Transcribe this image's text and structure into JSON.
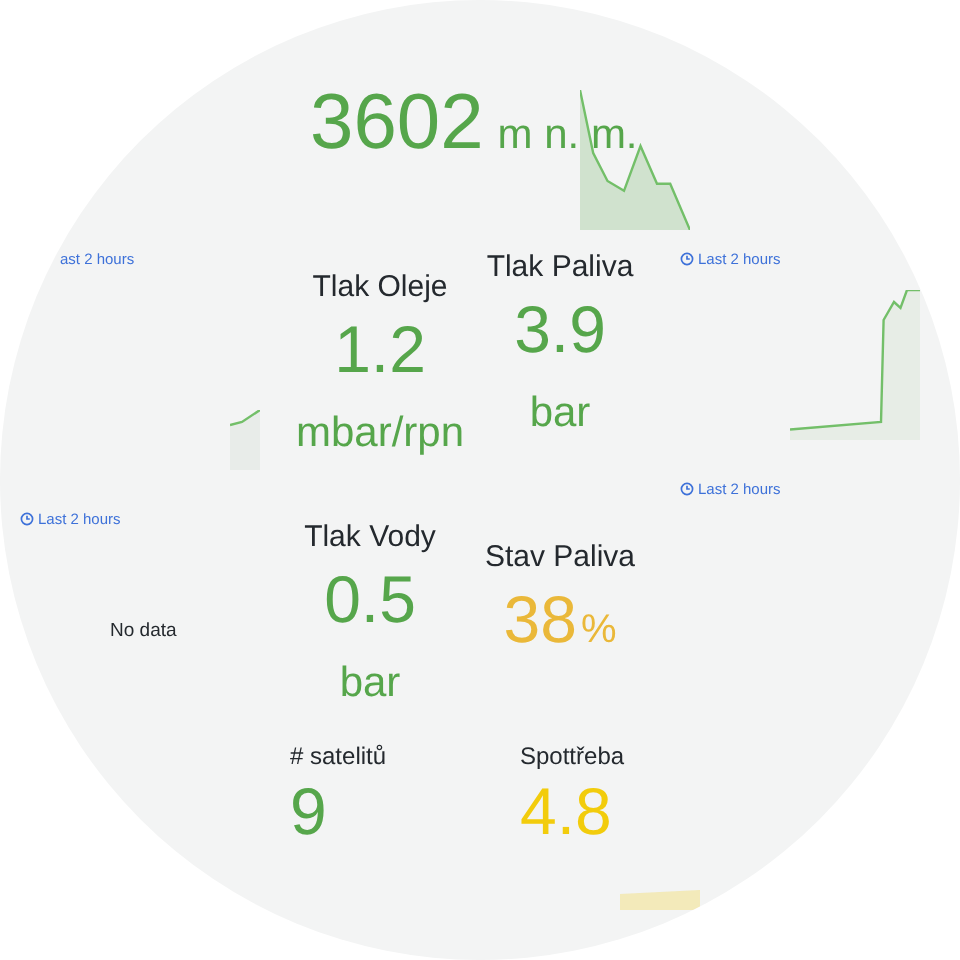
{
  "altitude": {
    "value": "3602",
    "unit": "m n. m.",
    "color": "#56a64b"
  },
  "time_ranges": [
    {
      "label": "ast 2 hours",
      "icon": false
    },
    {
      "label": "Last 2 hours",
      "icon": true
    },
    {
      "label": "Last 2 hours",
      "icon": true
    },
    {
      "label": "Last 2 hours",
      "icon": true
    }
  ],
  "stats": [
    {
      "title": "Tlak Oleje",
      "value": "1.2",
      "unit": "mbar/rpn",
      "kind": "unit_below",
      "color": "#56a64b"
    },
    {
      "title": "Tlak Paliva",
      "value": "3.9",
      "unit": "bar",
      "kind": "unit_below",
      "color": "#56a64b"
    },
    {
      "title": "Tlak Vody",
      "value": "0.5",
      "unit": "bar",
      "kind": "unit_below",
      "color": "#56a64b"
    },
    {
      "title": "Stav Paliva",
      "value": "38",
      "unit": "%",
      "kind": "unit_inline",
      "color": "#eab839"
    },
    {
      "title": "# satelitů",
      "value": "9",
      "kind": "plain",
      "color": "#56a64b"
    },
    {
      "title": "Spottřeba",
      "value": "4.8",
      "kind": "plain",
      "color": "#f2cc0c"
    }
  ],
  "no_data": "No data"
}
